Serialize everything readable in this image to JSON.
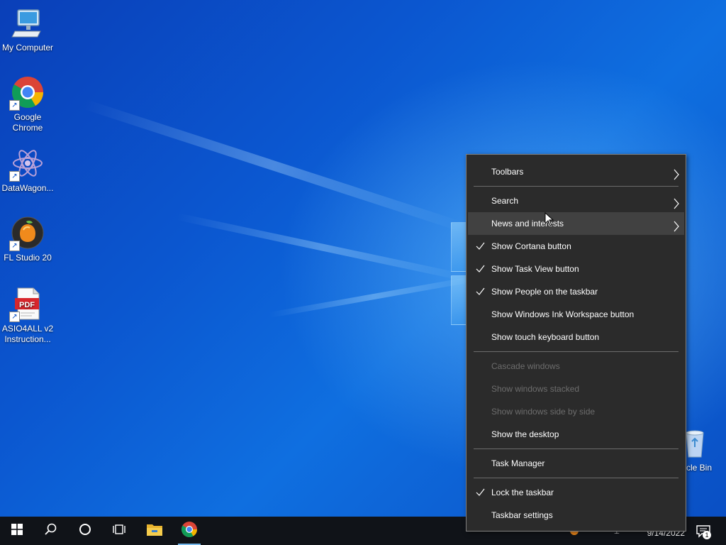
{
  "desktop": {
    "icons": [
      {
        "label": "My Computer"
      },
      {
        "label": "Google Chrome"
      },
      {
        "label": "DataWagon..."
      },
      {
        "label": "FL Studio 20"
      },
      {
        "label": "ASIO4ALL v2 Instruction..."
      },
      {
        "label": "cle Bin"
      }
    ],
    "pdf_badge": "PDF"
  },
  "context_menu": {
    "items": [
      {
        "label": "Toolbars",
        "submenu": true
      },
      {
        "label": "Search",
        "submenu": true
      },
      {
        "label": "News and interests",
        "submenu": true,
        "highlighted": true
      },
      {
        "label": "Show Cortana button",
        "checked": true
      },
      {
        "label": "Show Task View button",
        "checked": true
      },
      {
        "label": "Show People on the taskbar",
        "checked": true
      },
      {
        "label": "Show Windows Ink Workspace button"
      },
      {
        "label": "Show touch keyboard button"
      },
      {
        "label": "Cascade windows",
        "disabled": true
      },
      {
        "label": "Show windows stacked",
        "disabled": true
      },
      {
        "label": "Show windows side by side",
        "disabled": true
      },
      {
        "label": "Show the desktop"
      },
      {
        "label": "Task Manager"
      },
      {
        "label": "Lock the taskbar",
        "checked": true
      },
      {
        "label": "Taskbar settings"
      }
    ]
  },
  "taskbar": {
    "buttons": [
      "start-icon",
      "search-icon",
      "cortana-icon",
      "task-view-icon",
      "file-explorer-icon",
      "chrome-icon"
    ],
    "clock_date": "9/14/2022",
    "notification_count": "1",
    "accent_color": "#76b9ed"
  }
}
